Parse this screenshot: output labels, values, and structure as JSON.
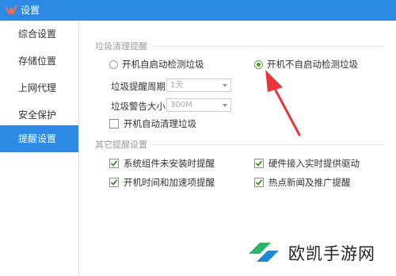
{
  "window": {
    "title": "设置"
  },
  "sidebar": {
    "items": [
      {
        "label": "综合设置",
        "active": false
      },
      {
        "label": "存储位置",
        "active": false
      },
      {
        "label": "上网代理",
        "active": false
      },
      {
        "label": "安全保护",
        "active": false
      },
      {
        "label": "提醒设置",
        "active": true
      }
    ]
  },
  "trash": {
    "section_title": "垃圾清理提醒",
    "radio_auto_detect": "开机自启动检测垃圾",
    "radio_no_auto_detect": "开机不自启动检测垃圾",
    "selected": "开机不自启动检测垃圾",
    "period_label": "垃圾提醒周期",
    "period_value": "1天",
    "size_label": "垃圾警告大小",
    "size_value": "300M",
    "auto_clean_label": "开机自动清理垃圾",
    "auto_clean_checked": false
  },
  "other": {
    "section_title": "其它提醒设置",
    "items": [
      {
        "label": "系统组件未安装时提醒",
        "checked": true
      },
      {
        "label": "硬件接入实时提供驱动",
        "checked": true
      },
      {
        "label": "开机时间和加速项提醒",
        "checked": true
      },
      {
        "label": "热点新闻及推广提醒",
        "checked": true
      }
    ]
  },
  "watermark": {
    "text": "欧凯手游网"
  },
  "colors": {
    "accent": "#2d8be6",
    "annotation": "#e8343b",
    "radio_on": "#4f9a2f",
    "check_mark": "#3a8a2a"
  },
  "icons": {
    "app_logo": "app-logo-icon",
    "watermark_logo": "watermark-logo-icon"
  }
}
